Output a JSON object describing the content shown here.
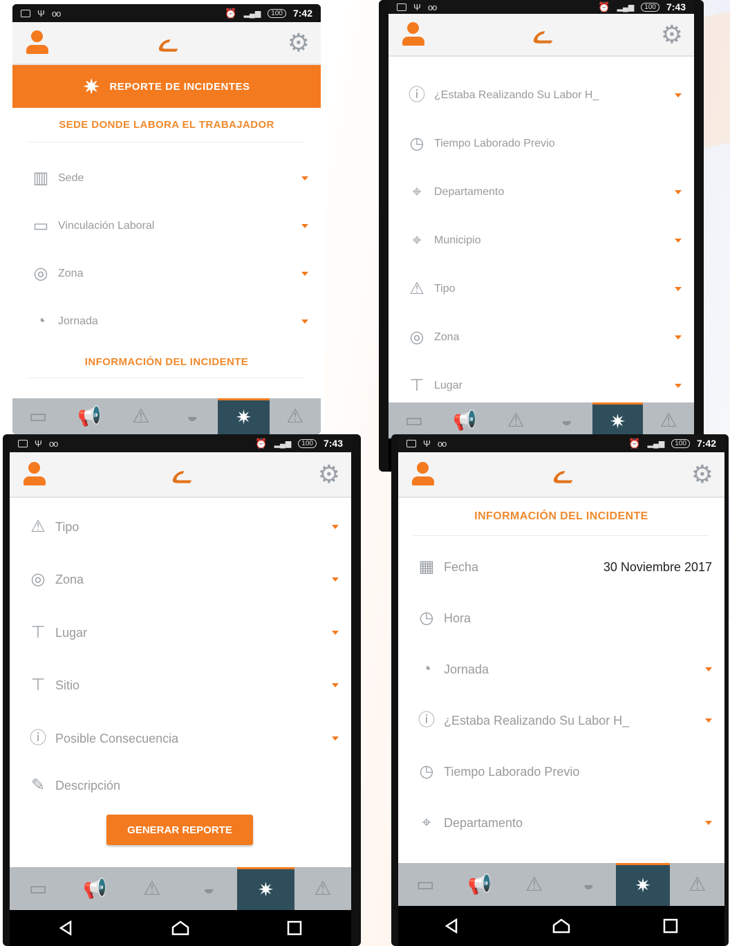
{
  "status": {
    "p1_time": "7:42",
    "p2_time": "7:43",
    "p3_time": "7:43",
    "p4_time": "7:42",
    "battery": "100"
  },
  "brand": {
    "accent": "#f47a1f",
    "tab_active_bg": "#2f4e5c",
    "tabbar_bg": "#b7bcc1"
  },
  "icons": {
    "user": "user-icon",
    "logo": "brand-logo",
    "gear": "gear-icon"
  },
  "p1": {
    "banner": "REPORTE DE INCIDENTES",
    "section1": "SEDE DONDE LABORA EL TRABAJADOR",
    "fields": [
      "Sede",
      "Vinculación Laboral",
      "Zona",
      "Jornada"
    ],
    "section2": "INFORMACIÓN DEL INCIDENTE"
  },
  "p2": {
    "fields": [
      "¿Estaba Realizando Su Labor H_",
      "Tiempo Laborado Previo",
      "Departamento",
      "Municipio",
      "Tipo",
      "Zona",
      "Lugar"
    ]
  },
  "p3": {
    "fields": [
      "Tipo",
      "Zona",
      "Lugar",
      "Sitio",
      "Posible Consecuencia",
      "Descripción"
    ],
    "button": "GENERAR REPORTE"
  },
  "p4": {
    "section": "INFORMACIÓN DEL INCIDENTE",
    "fecha_label": "Fecha",
    "fecha_value": "30 Noviembre 2017",
    "fields": [
      "Hora",
      "Jornada",
      "¿Estaba Realizando Su Labor H_",
      "Tiempo Laborado Previo",
      "Departamento"
    ]
  }
}
